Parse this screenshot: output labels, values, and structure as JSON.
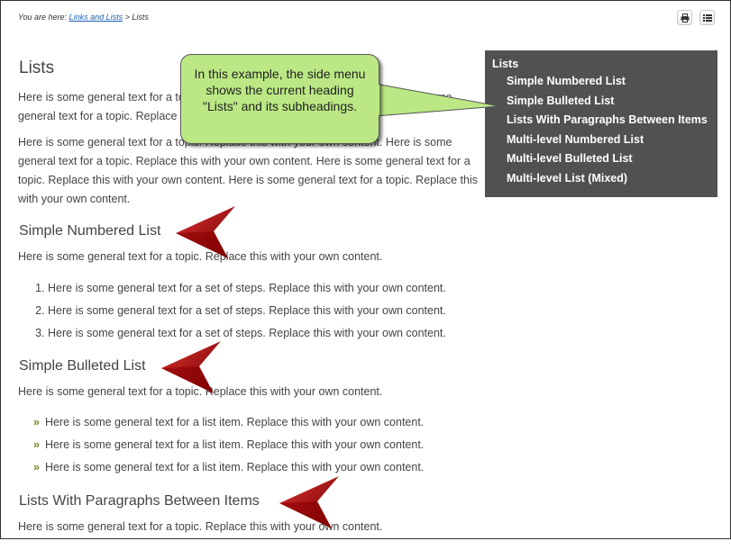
{
  "breadcrumb": {
    "prefix": "You are here:",
    "link": "Links and Lists",
    "separator": ">",
    "current": "Lists"
  },
  "toolbar": {
    "print_icon": "printer-icon",
    "menu_icon": "list-icon"
  },
  "content": {
    "title": "Lists",
    "intro_p1": "Here is some general text for a topic. Replace this with your own content. Here is some general text for a topic. Replace this with your own content.",
    "intro_p2": "Here is some general text for a topic. Replace this with your own content. Here is some general text for a topic. Replace this with your own content. Here is some general text for a topic. Replace this with your own content. Here is some general text for a topic. Replace this with your own content.",
    "sections": {
      "numbered": {
        "heading": "Simple Numbered List",
        "text": "Here is some general text for a topic. Replace this with your own content.",
        "items": [
          "Here is some general text for a set of steps. Replace this with your own content.",
          "Here is some general text for a set of steps. Replace this with your own content.",
          "Here is some general text for a set of steps. Replace this with your own content."
        ]
      },
      "bulleted": {
        "heading": "Simple Bulleted List",
        "text": "Here is some general text for a topic. Replace this with your own content.",
        "bullet": "»",
        "items": [
          "Here is some general text for a list item. Replace this with your own content.",
          "Here is some general text for a list item. Replace this with your own content.",
          "Here is some general text for a list item. Replace this with your own content."
        ]
      },
      "paragraphs": {
        "heading": "Lists With Paragraphs Between Items",
        "text": "Here is some general text for a topic. Replace this with your own content."
      }
    }
  },
  "side_menu": {
    "title": "Lists",
    "items": [
      "Simple Numbered List",
      "Simple Bulleted List",
      "Lists With Paragraphs Between Items",
      "Multi-level Numbered List",
      "Multi-level Bulleted List",
      "Multi-level List (Mixed)"
    ]
  },
  "callout": {
    "text": "In this example, the side menu shows the current heading \"Lists\" and its subheadings."
  },
  "colors": {
    "callout_fill": "#bbe884",
    "side_menu_bg": "#515151",
    "arrow_red": "#b30000",
    "link": "#1a5fb4",
    "bullet": "#7a8b1a"
  }
}
